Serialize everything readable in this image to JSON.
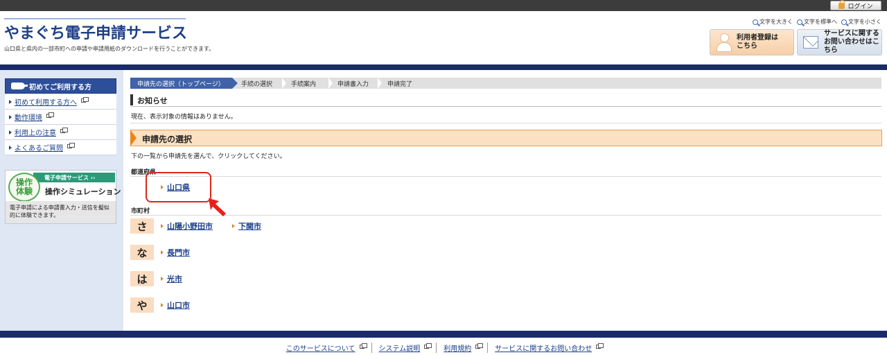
{
  "header": {
    "login_label": "ログイン",
    "site_title": "やまぐち電子申請サービス",
    "site_description": "山口県と県内の一部市町への申請や申請用紙のダウンロードを行うことができます。",
    "font_controls": [
      "文字を大きく",
      "文字を標準へ",
      "文字を小さく"
    ],
    "register_button": [
      "利用者登録は",
      "こちら"
    ],
    "contact_button": [
      "サービスに関する",
      "お問い合わせはこちら"
    ]
  },
  "sidebar": {
    "heading": "初めてご利用する方",
    "items": [
      {
        "label": "初めて利用する方へ"
      },
      {
        "label": "動作環境"
      },
      {
        "label": "利用上の注意"
      },
      {
        "label": "よくあるご質問"
      }
    ],
    "simulation": {
      "badge": "操作\n体験",
      "service_label": "電子申請サービス ››",
      "title": "操作シミュレーション",
      "description": "電子申請による申請書入力・送信を擬似的に体験できます。"
    }
  },
  "steps": [
    "申請先の選択（トップページ）",
    "手続の選択",
    "手続案内",
    "申請書入力",
    "申請完了"
  ],
  "notice": {
    "heading": "お知らせ",
    "text": "現在、表示対象の情報はありません。"
  },
  "selection": {
    "heading": "申請先の選択",
    "instruction": "下の一覧から申請先を選んで、クリックしてください。",
    "prefecture_label": "都道府県",
    "prefecture": "山口県",
    "municipality_label": "市町村",
    "groups": [
      {
        "kana": "さ",
        "cities": [
          "山陽小野田市",
          "下関市"
        ]
      },
      {
        "kana": "な",
        "cities": [
          "長門市"
        ]
      },
      {
        "kana": "は",
        "cities": [
          "光市"
        ]
      },
      {
        "kana": "や",
        "cities": [
          "山口市"
        ]
      }
    ]
  },
  "footer": {
    "links": [
      "このサービスについて",
      "システム説明",
      "利用規約",
      "サービスに関するお問い合わせ"
    ]
  },
  "colors": {
    "navy_band": "#1b2a6b",
    "title_blue": "#1d3f86",
    "highlight_red": "#d9261c",
    "section_orange": "#fbe1c1"
  }
}
